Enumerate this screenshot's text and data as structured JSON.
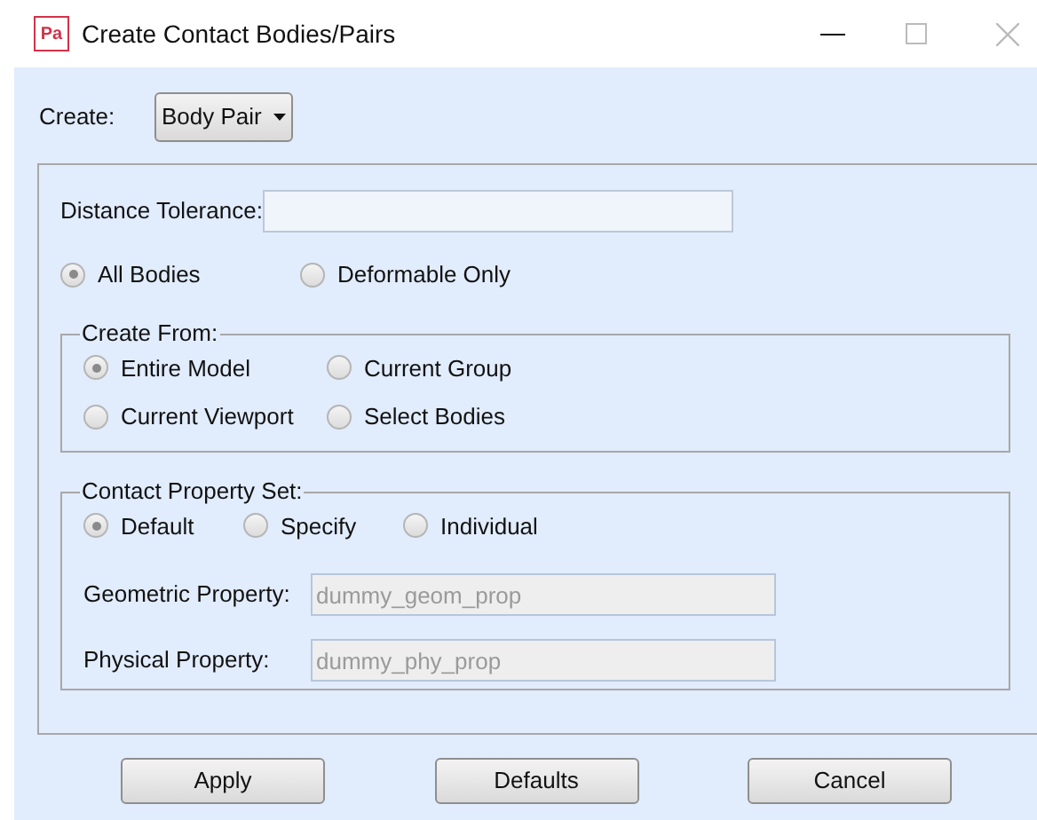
{
  "window": {
    "title": "Create Contact Bodies/Pairs",
    "app_badge": "Pa"
  },
  "create": {
    "label": "Create:",
    "value": "Body Pair"
  },
  "distance_tolerance": {
    "label": "Distance Tolerance:"
  },
  "body_scope": [
    {
      "label": "All Bodies",
      "selected": true
    },
    {
      "label": "Deformable Only",
      "selected": false
    }
  ],
  "create_from": {
    "title": "Create From:",
    "options": [
      {
        "label": "Entire Model",
        "selected": true
      },
      {
        "label": "Current Group",
        "selected": false
      },
      {
        "label": "Current Viewport",
        "selected": false
      },
      {
        "label": "Select Bodies",
        "selected": false
      }
    ]
  },
  "contact_property_set": {
    "title": "Contact Property Set:",
    "options": [
      {
        "label": "Default",
        "selected": true
      },
      {
        "label": "Specify",
        "selected": false
      },
      {
        "label": "Individual",
        "selected": false
      }
    ],
    "fields": [
      {
        "label": "Geometric Property:",
        "value": "dummy_geom_prop",
        "disabled": true
      },
      {
        "label": "Physical Property:",
        "value": "dummy_phy_prop",
        "disabled": true
      }
    ]
  },
  "buttons": [
    "Apply",
    "Defaults",
    "Cancel"
  ]
}
